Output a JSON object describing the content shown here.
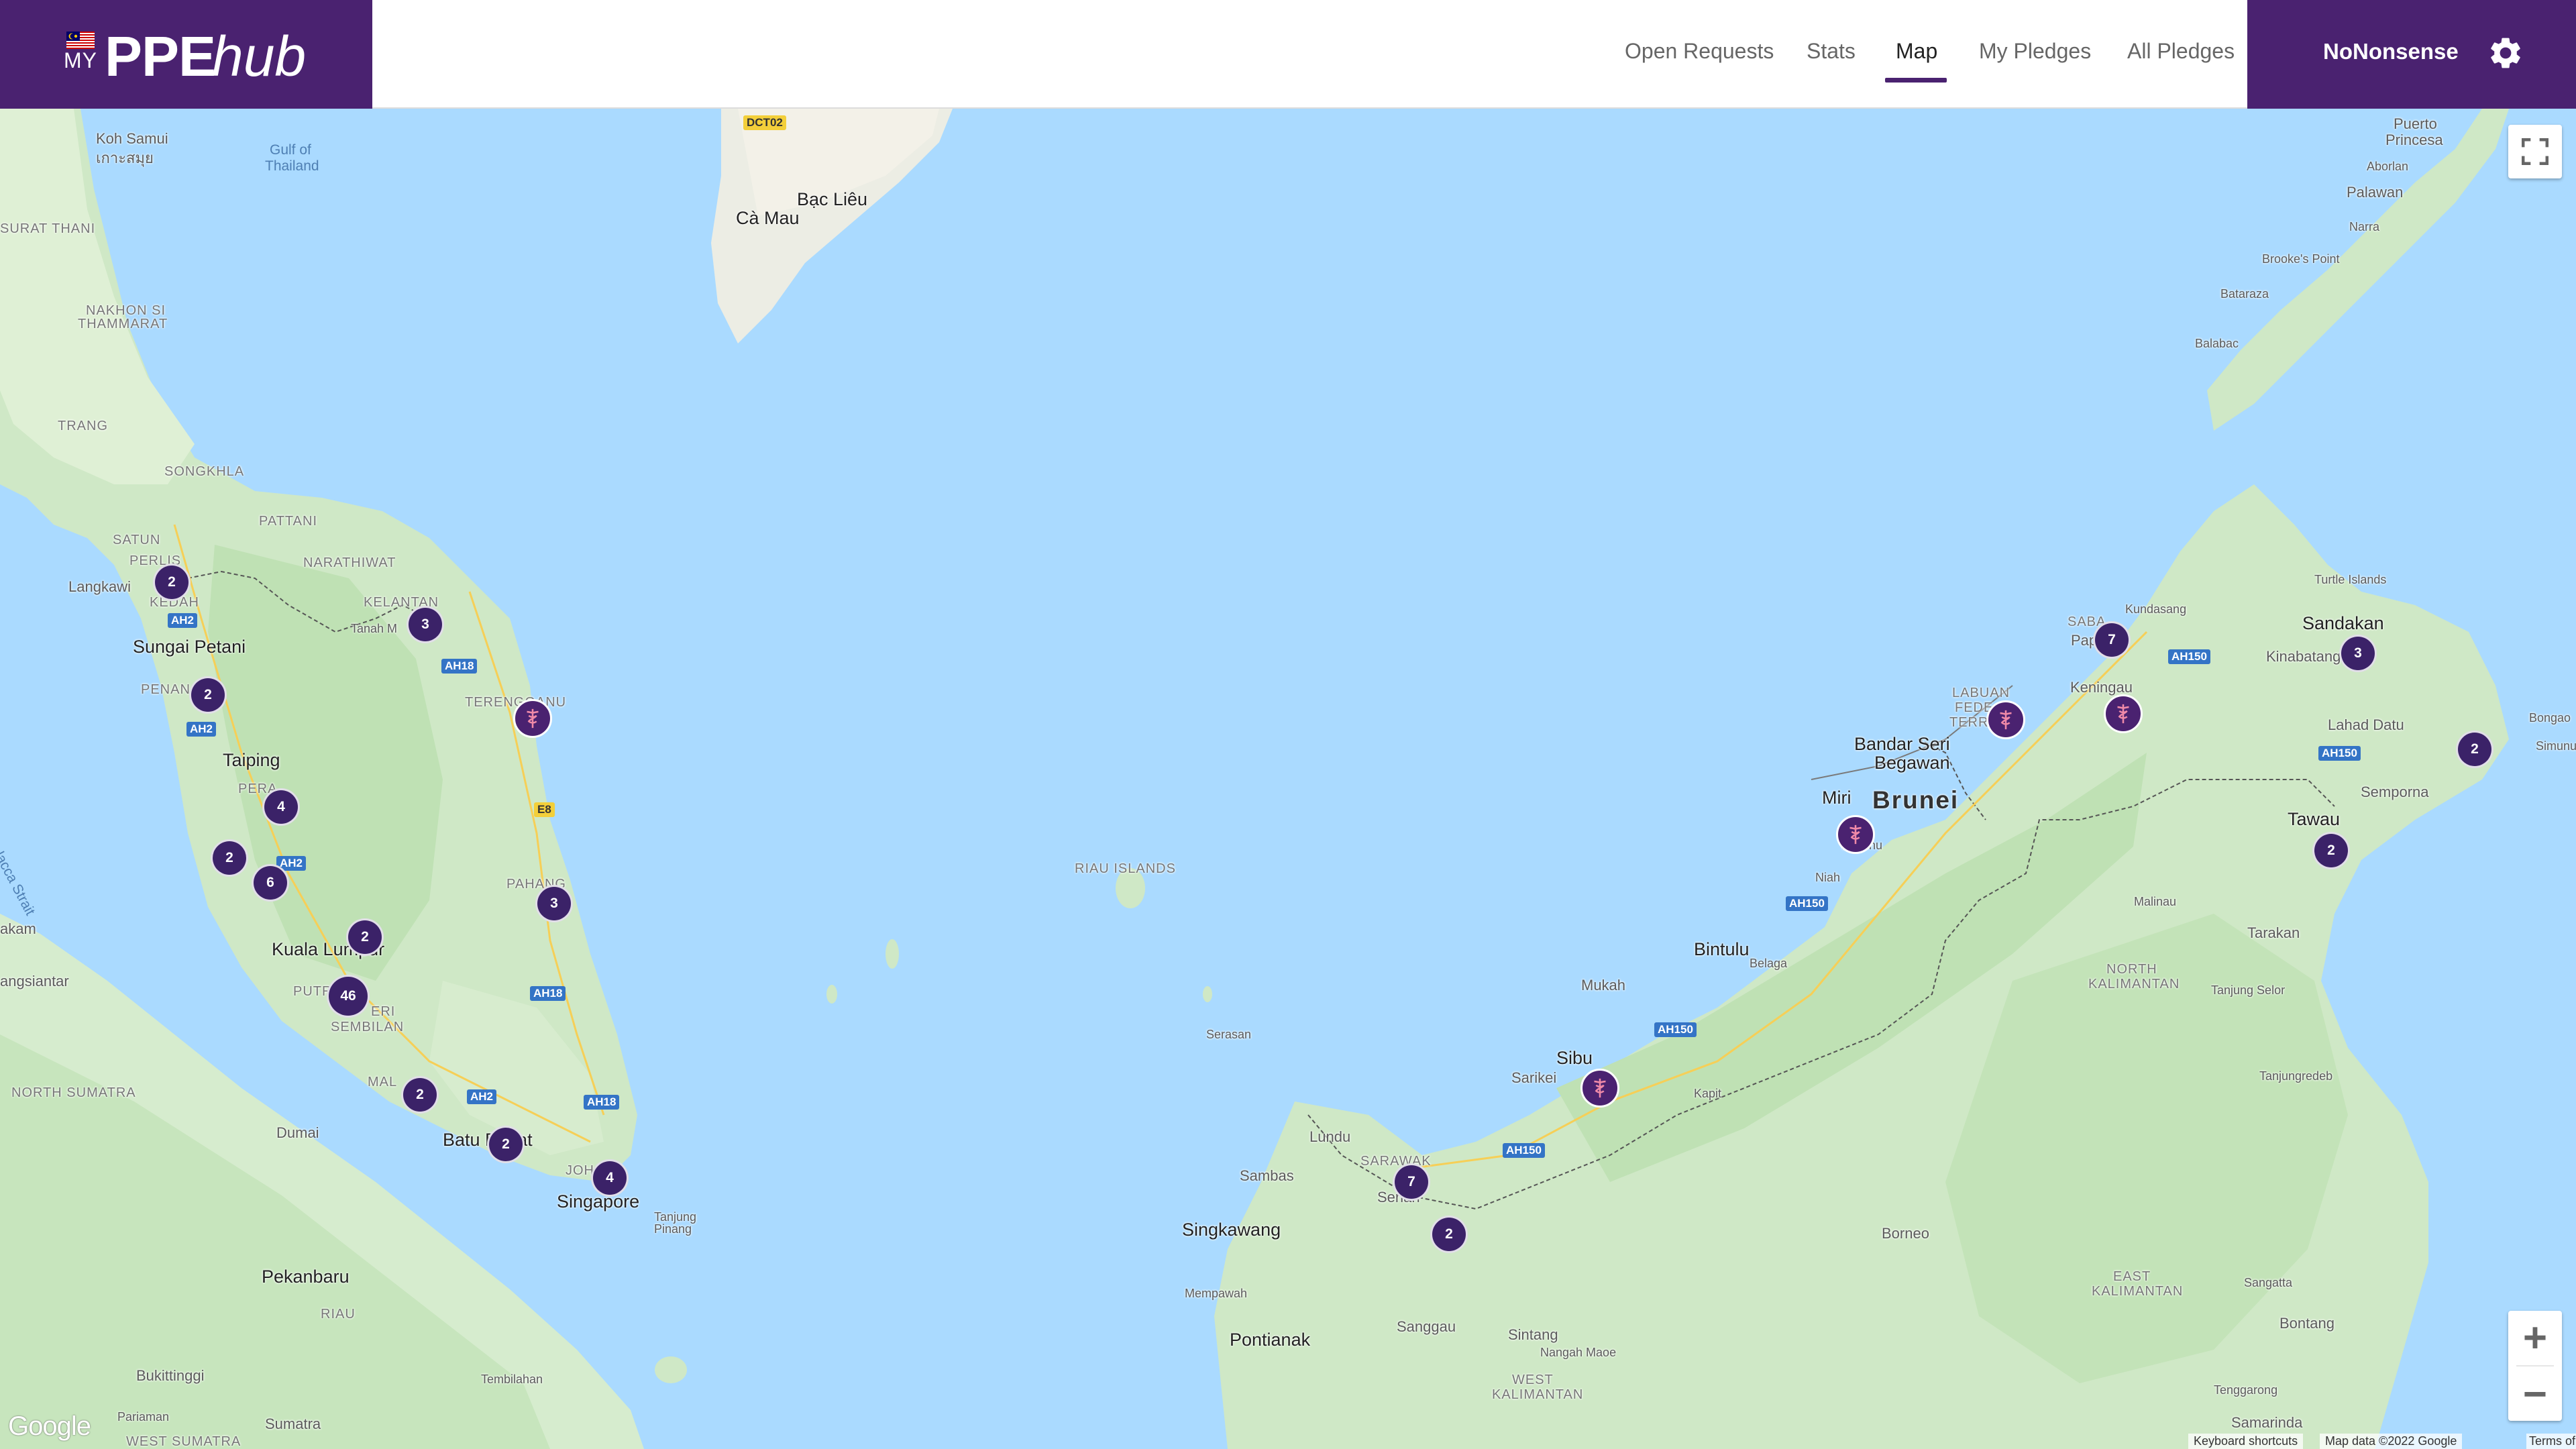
{
  "header": {
    "logo_prefix": "MY",
    "logo_main": "PPE",
    "logo_suffix": "hub",
    "nav": {
      "open_requests": "Open Requests",
      "stats": "Stats",
      "map": "Map",
      "my_pledges": "My Pledges",
      "all_pledges": "All Pledges"
    },
    "active_nav": "Map",
    "username": "NoNonsense"
  },
  "map": {
    "places": {
      "koh_samui": "Koh Samui",
      "koh_samui_thai": "เกาะสมุย",
      "gulf_of": "Gulf of",
      "thailand": "Thailand",
      "surat_thani": "SURAT THANI",
      "nakhon_si": "NAKHON SI",
      "thammarat": "THAMMARAT",
      "trang": "TRANG",
      "songkhla": "SONGKHLA",
      "satun": "SATUN",
      "pattani": "PATTANI",
      "narathiwat": "NARATHIWAT",
      "langkawi": "Langkawi",
      "perlis": "PERLIS",
      "kedah": "KEDAH",
      "kelantan": "KELANTAN",
      "tanah_merah": "Tanah M",
      "sungai_petani": "Sungai Petani",
      "penang": "PENAN",
      "terengganu": "TERENGGANU",
      "taiping": "Taiping",
      "perak": "PERA",
      "pahang": "PAHANG",
      "kuala_lumpur": "Kuala Lumpur",
      "putra": "PUTR",
      "sembilan": "SEMBILAN",
      "negeri": "ERI",
      "malacca": "MAL",
      "batu_pahat": "Batu Pahat",
      "johor": "JOH",
      "singapore": "Singapore",
      "tanjung_pinang": "Tanjung",
      "pinang": "Pinang",
      "north_sumatra": "NORTH SUMATRA",
      "siantar": "angsiantar",
      "kisaran": "akam",
      "dumai": "Dumai",
      "pekanbaru": "Pekanbaru",
      "riau": "RIAU",
      "bukittinggi": "Bukittinggi",
      "pariaman": "Pariaman",
      "tembilahan": "Tembilahan",
      "sumatra": "Sumatra",
      "west_sumatra": "WEST SUMATRA",
      "malacca_strait": "Malacca Strait",
      "riau_islands": "RIAU ISLANDS",
      "serasan": "Serasan",
      "bac_lieu": "Bạc Liêu",
      "ca_mau": "Cà Mau",
      "lundu": "Lundu",
      "sambas": "Sambas",
      "sarawak": "SARAWAK",
      "kuching": "Serian",
      "singkawang": "Singkawang",
      "mempawah": "Mempawah",
      "pontianak": "Pontianak",
      "sanggau": "Sanggau",
      "sintang": "Sintang",
      "nangah_maoe": "Nangah Maoe",
      "west": "WEST",
      "kalimantan_w": "KALIMANTAN",
      "sibu": "Sibu",
      "sarikei": "Sarikei",
      "mukah": "Mukah",
      "kapit": "Kapit",
      "bintulu": "Bintulu",
      "belaga": "Belaga",
      "miri": "Miri",
      "bekenu": "Bekenu",
      "niah": "Niah",
      "brunei": "Brunei",
      "bandar_seri": "Bandar Seri",
      "begawan": "Begawan",
      "labuan": "LABUAN",
      "feder": "FEDE",
      "terr": "TERR",
      "sabah": "SABA",
      "papar": "Papar",
      "keningau": "Keningau",
      "kundasang": "Kundasang",
      "kinabatangan": "Kinabatang",
      "sandakan": "Sandakan",
      "turtle_islands": "Turtle Islands",
      "lahad_datu": "Lahad Datu",
      "semporna": "Semporna",
      "tawau": "Tawau",
      "bongao": "Bongao",
      "simunul": "Simunul",
      "malinau": "Malinau",
      "tarakan": "Tarakan",
      "tanjung_selor": "Tanjung Selor",
      "north_kalimantan_1": "NORTH",
      "north_kalimantan_2": "KALIMANTAN",
      "tanjungredeb": "Tanjungredeb",
      "east": "EAST",
      "kalimantan_e": "KALIMANTAN",
      "borneo": "Borneo",
      "sangatta": "Sangatta",
      "bontang": "Bontang",
      "samarinda": "Samarinda",
      "tenggarong": "Tenggarong",
      "puerto": "Puerto",
      "princesa": "Princesa",
      "aborlan": "Aborlan",
      "palawan": "Palawan",
      "narra": "Narra",
      "brookes_point": "Brooke's Point",
      "bataraza": "Bataraza",
      "balabac": "Balabac"
    },
    "highways": {
      "dct02": "DCT02",
      "ah2_a": "AH2",
      "ah2_b": "AH2",
      "ah2_c": "AH2",
      "ah2_d": "AH2",
      "ah18_a": "AH18",
      "ah18_b": "AH18",
      "ah18_c": "AH18",
      "e8": "E8",
      "ah150_a": "AH150",
      "ah150_b": "AH150",
      "ah150_c": "AH150",
      "ah150_d": "AH150",
      "ah150_e": "AH150"
    },
    "clusters": {
      "kedah": "2",
      "kelantan": "3",
      "penang": "2",
      "perak": "4",
      "perak_w": "2",
      "perak_s": "6",
      "pahang": "3",
      "selangor": "2",
      "kl": "46",
      "malacca": "2",
      "batu_pahat": "2",
      "johor": "4",
      "sarawak_w": "7",
      "sarawak_s": "2",
      "sabah_w": "7",
      "sandakan": "3",
      "semporna": "2",
      "tawau": "2"
    },
    "controls": {
      "zoom_in": "+",
      "zoom_out": "−"
    },
    "google_logo": "Google",
    "attribution": {
      "shortcuts": "Keyboard shortcuts",
      "map_data": "Map data ©2022 Google",
      "terms": "Terms of Use"
    }
  }
}
